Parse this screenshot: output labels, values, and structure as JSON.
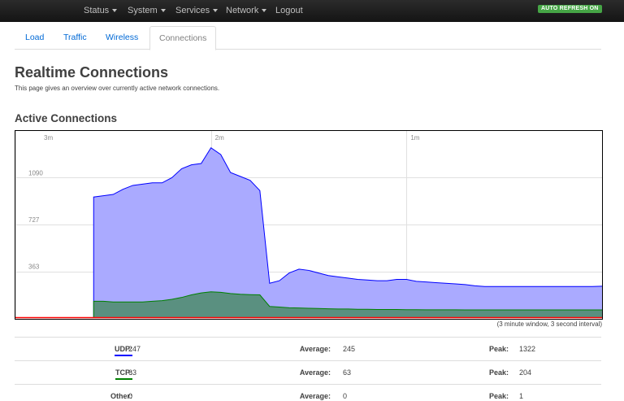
{
  "navbar": {
    "items": [
      {
        "label": "Status",
        "dropdown": true
      },
      {
        "label": "System",
        "dropdown": true
      },
      {
        "label": "Services",
        "dropdown": true
      },
      {
        "label": "Network",
        "dropdown": true
      },
      {
        "label": "Logout",
        "dropdown": false
      }
    ],
    "auto_refresh": "AUTO REFRESH ON",
    "auto_refresh_color": "#46a546"
  },
  "tabs": [
    {
      "label": "Load",
      "active": false
    },
    {
      "label": "Traffic",
      "active": false
    },
    {
      "label": "Wireless",
      "active": false
    },
    {
      "label": "Connections",
      "active": true
    }
  ],
  "page": {
    "title": "Realtime Connections",
    "description": "This page gives an overview over currently active network connections.",
    "section_title": "Active Connections",
    "window_note": "(3 minute window, 3 second interval)"
  },
  "chart_data": {
    "type": "area",
    "x_tick_labels": [
      "3m",
      "2m",
      "1m"
    ],
    "y_tick_labels": [
      "1090",
      "727",
      "363"
    ],
    "y_ticks": [
      1090,
      727,
      363
    ],
    "ylim": [
      0,
      1453
    ],
    "x_unit": "seconds ago",
    "xlim": [
      180,
      0
    ],
    "grid": true,
    "colors": {
      "udp_fill": "#aaaaff",
      "udp_line": "#0000ff",
      "tcp_fill": "#5a9080",
      "tcp_line": "#008000",
      "other_line": "#ff0000"
    },
    "series": [
      {
        "name": "UDP",
        "x": [
          156,
          153,
          150,
          147,
          144,
          141,
          138,
          135,
          132,
          129,
          126,
          123,
          120,
          117,
          114,
          111,
          108,
          105,
          102,
          99,
          96,
          93,
          90,
          87,
          84,
          81,
          78,
          75,
          72,
          69,
          66,
          63,
          60,
          57,
          54,
          51,
          48,
          45,
          42,
          39,
          36,
          33,
          30,
          27,
          24,
          21,
          18,
          15,
          12,
          9,
          6,
          3,
          0
        ],
        "values": [
          940,
          950,
          960,
          1000,
          1030,
          1040,
          1050,
          1050,
          1090,
          1160,
          1190,
          1200,
          1322,
          1270,
          1130,
          1100,
          1070,
          990,
          270,
          290,
          350,
          380,
          370,
          350,
          330,
          320,
          310,
          300,
          295,
          290,
          290,
          300,
          300,
          285,
          280,
          275,
          270,
          265,
          260,
          250,
          245,
          245,
          245,
          245,
          245,
          245,
          245,
          245,
          245,
          245,
          245,
          245,
          247
        ]
      },
      {
        "name": "TCP",
        "x": [
          156,
          153,
          150,
          147,
          144,
          141,
          138,
          135,
          132,
          129,
          126,
          123,
          120,
          117,
          114,
          111,
          108,
          105,
          102,
          99,
          96,
          93,
          90,
          87,
          84,
          81,
          78,
          75,
          72,
          69,
          66,
          63,
          60,
          57,
          54,
          51,
          48,
          45,
          42,
          39,
          36,
          33,
          30,
          27,
          24,
          21,
          18,
          15,
          12,
          9,
          6,
          3,
          0
        ],
        "values": [
          130,
          130,
          125,
          125,
          125,
          125,
          130,
          135,
          145,
          160,
          180,
          195,
          204,
          200,
          190,
          185,
          182,
          180,
          90,
          85,
          80,
          78,
          76,
          74,
          72,
          70,
          70,
          68,
          68,
          66,
          66,
          66,
          65,
          65,
          64,
          64,
          64,
          64,
          63,
          63,
          63,
          63,
          63,
          63,
          63,
          63,
          63,
          63,
          63,
          63,
          63,
          63,
          63
        ]
      },
      {
        "name": "Other",
        "x": [
          180,
          0
        ],
        "values": [
          0,
          0
        ]
      }
    ]
  },
  "stats": [
    {
      "label": "UDP",
      "current": "247",
      "average_label": "Average:",
      "average": "245",
      "peak_label": "Peak:",
      "peak": "1322",
      "color": "#0000ff"
    },
    {
      "label": "TCP",
      "current": "63",
      "average_label": "Average:",
      "average": "63",
      "peak_label": "Peak:",
      "peak": "204",
      "color": "#008000"
    },
    {
      "label": "Other",
      "current": "0",
      "average_label": "Average:",
      "average": "0",
      "peak_label": "Peak:",
      "peak": "1",
      "color": "#ff0000"
    }
  ]
}
